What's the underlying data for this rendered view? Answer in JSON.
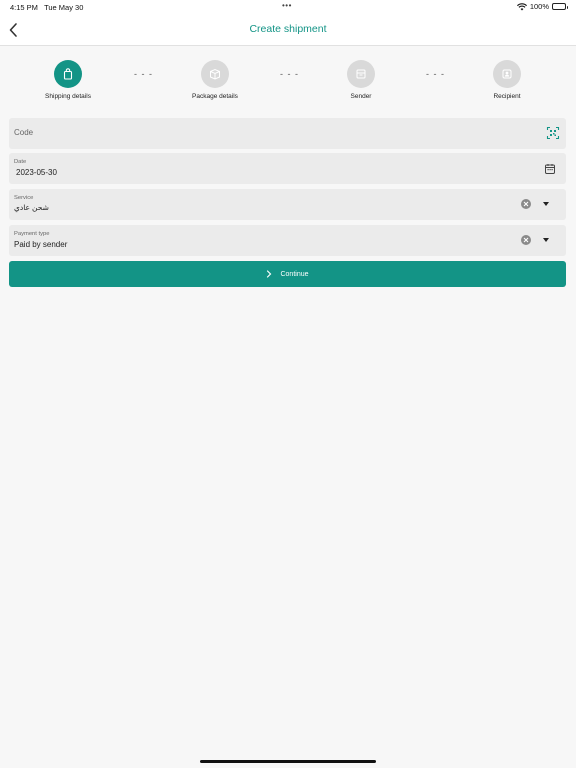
{
  "status_bar": {
    "time": "4:15 PM",
    "date": "Tue May 30",
    "dots": "•••",
    "battery": "100%"
  },
  "nav": {
    "title": "Create shipment"
  },
  "stepper": {
    "steps": [
      {
        "label": "Shipping details",
        "active": true,
        "icon": "bag-icon"
      },
      {
        "label": "Package details",
        "active": false,
        "icon": "box-icon"
      },
      {
        "label": "Sender",
        "active": false,
        "icon": "store-icon"
      },
      {
        "label": "Recipient",
        "active": false,
        "icon": "person-icon"
      }
    ],
    "separator": "- - -"
  },
  "form": {
    "code": {
      "placeholder": "Code",
      "icon": "qr-scan-icon"
    },
    "date": {
      "label": "Date",
      "value": "2023-05-30",
      "icon": "calendar-icon"
    },
    "service": {
      "label": "Service",
      "value": "شحن عادي"
    },
    "payment_type": {
      "label": "Payment type",
      "value": "Paid by sender"
    }
  },
  "continue_button": {
    "label": "Continue"
  },
  "colors": {
    "accent": "#139486",
    "inactive_step": "#d9d9d9",
    "field_bg": "#ebebeb"
  }
}
